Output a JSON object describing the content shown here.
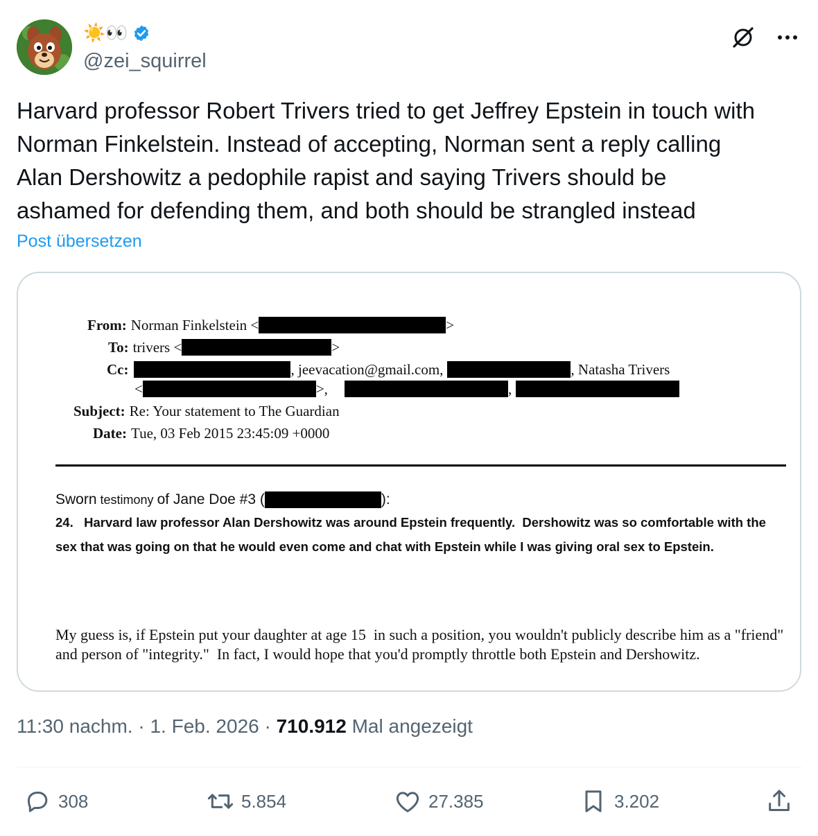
{
  "author": {
    "display_emojis": "☀️👀",
    "handle": "@zei_squirrel",
    "avatar_icon": "squirrel-avatar-icon",
    "verified_icon": "verified-badge-icon"
  },
  "tweet": {
    "text": "Harvard professor Robert Trivers tried to get Jeffrey Epstein in touch with\nNorman Finkelstein. Instead of accepting, Norman sent a reply calling\nAlan Dershowitz a pedophile rapist and saying Trivers should be\nashamed for defending them, and both should be strangled instead",
    "translate_label": "Post übersetzen"
  },
  "document": {
    "from_label": "From:",
    "from_value": "Norman Finkelstein <",
    "to_label": "To:",
    "to_value": "trivers <",
    "cc_label": "Cc:",
    "cc_email": ", jeevacation@gmail.com,",
    "cc_name": ", Natasha Trivers",
    "subject_label": "Subject:",
    "subject_value": "Re: Your statement to The Guardian",
    "date_label": "Date:",
    "date_value": "Tue, 03 Feb 2015 23:45:09 +0000",
    "sworn_part1": "Sworn",
    "sworn_part2": "testimony",
    "sworn_part3": "of Jane Doe #3 (",
    "sworn_close": "):",
    "para_24": "24.   Harvard law professor Alan Dershowitz was around Epstein frequently.  Dershowitz was so comfortable with the sex that was going on that he would even come and chat with Epstein while I was giving oral sex to Epstein.",
    "guess_text": "My guess is, if Epstein put your daughter at age 15  in such a position, you wouldn't publicly describe him as a \"friend\" and person of \"integrity.\"  In fact, I would hope that you'd promptly throttle both Epstein and Dershowitz."
  },
  "meta": {
    "time": "11:30 nachm.",
    "sep1": " · ",
    "date": "1. Feb. 2026",
    "sep2": " · ",
    "views_count": "710.912",
    "views_label": " Mal angezeigt"
  },
  "actions": {
    "replies": "308",
    "reposts": "5.854",
    "likes": "27.385",
    "bookmarks": "3.202"
  },
  "colors": {
    "accent": "#1d9bf0",
    "secondary_text": "#536471",
    "border": "#cfd9de"
  }
}
